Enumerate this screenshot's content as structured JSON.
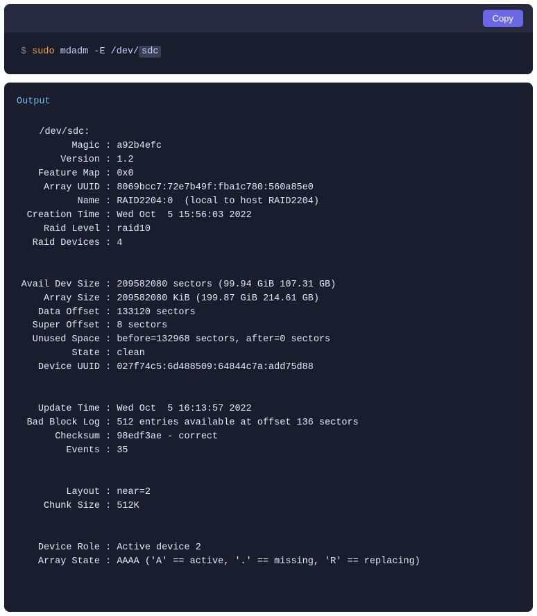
{
  "command_block": {
    "copy_label": "Copy",
    "prompt": "$ ",
    "sudo": "sudo",
    "cmd": "mdadm",
    "flag": "-E",
    "path": "/dev/",
    "hl": "sdc"
  },
  "output_block": {
    "label": "Output",
    "device_header": "/dev/sdc:",
    "block1": [
      {
        "k": "Magic",
        "v": "a92b4efc"
      },
      {
        "k": "Version",
        "v": "1.2"
      },
      {
        "k": "Feature Map",
        "v": "0x0"
      },
      {
        "k": "Array UUID",
        "v": "8069bcc7:72e7b49f:fba1c780:560a85e0"
      },
      {
        "k": "Name",
        "v": "RAID2204:0  (local to host RAID2204)"
      },
      {
        "k": "Creation Time",
        "v": "Wed Oct  5 15:56:03 2022"
      },
      {
        "k": "Raid Level",
        "v": "raid10"
      },
      {
        "k": "Raid Devices",
        "v": "4"
      }
    ],
    "block2": [
      {
        "k": "Avail Dev Size",
        "v": "209582080 sectors (99.94 GiB 107.31 GB)"
      },
      {
        "k": "Array Size",
        "v": "209582080 KiB (199.87 GiB 214.61 GB)"
      },
      {
        "k": "Data Offset",
        "v": "133120 sectors"
      },
      {
        "k": "Super Offset",
        "v": "8 sectors"
      },
      {
        "k": "Unused Space",
        "v": "before=132968 sectors, after=0 sectors"
      },
      {
        "k": "State",
        "v": "clean"
      },
      {
        "k": "Device UUID",
        "v": "027f74c5:6d488509:64844c7a:add75d88"
      }
    ],
    "block3": [
      {
        "k": "Update Time",
        "v": "Wed Oct  5 16:13:57 2022"
      },
      {
        "k": "Bad Block Log",
        "v": "512 entries available at offset 136 sectors"
      },
      {
        "k": "Checksum",
        "v": "98edf3ae - correct"
      },
      {
        "k": "Events",
        "v": "35"
      }
    ],
    "block4": [
      {
        "k": "Layout",
        "v": "near=2"
      },
      {
        "k": "Chunk Size",
        "v": "512K"
      }
    ],
    "block5": [
      {
        "k": "Device Role",
        "v": "Active device 2"
      },
      {
        "k": "Array State",
        "v": "AAAA ('A' == active, '.' == missing, 'R' == replacing)"
      }
    ]
  }
}
